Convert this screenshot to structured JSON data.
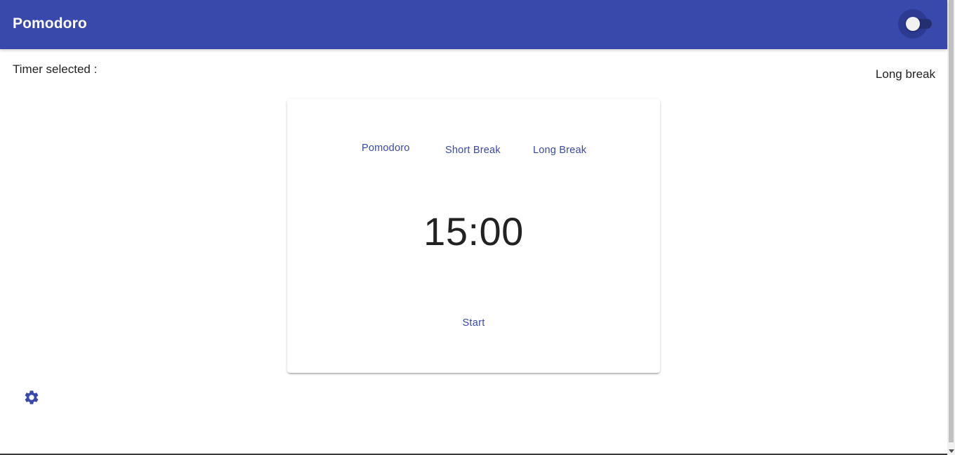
{
  "app_bar": {
    "title": "Pomodoro",
    "theme_toggle": {
      "state": "off"
    }
  },
  "selection": {
    "label": "Timer selected :",
    "value": "Long break"
  },
  "timer_card": {
    "tabs": [
      {
        "label": "Pomodoro"
      },
      {
        "label": "Short Break"
      },
      {
        "label": "Long Break"
      }
    ],
    "time": "15:00",
    "start_label": "Start"
  },
  "icons": {
    "settings": "gear-icon"
  },
  "colors": {
    "primary": "#3949ab",
    "text": "#222222",
    "background": "#ffffff"
  }
}
